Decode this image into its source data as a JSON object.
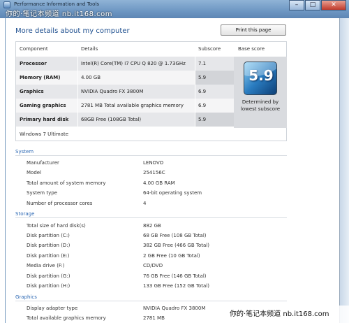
{
  "window": {
    "title": "Performance Information and Tools",
    "watermark_top": "你的·笔记本频道 nb.it168.com",
    "minimize": "–",
    "maximize": "□",
    "close": "✕"
  },
  "page": {
    "title": "More details about my computer",
    "print_label": "Print this page"
  },
  "score_table": {
    "headers": {
      "component": "Component",
      "details": "Details",
      "subscore": "Subscore",
      "base": "Base score"
    },
    "rows": [
      {
        "component": "Processor",
        "details": "Intel(R) Core(TM) i7 CPU Q 820 @ 1.73GHz",
        "subscore": "7.1"
      },
      {
        "component": "Memory (RAM)",
        "details": "4.00 GB",
        "subscore": "5.9"
      },
      {
        "component": "Graphics",
        "details": "NVIDIA Quadro FX 3800M",
        "subscore": "6.9"
      },
      {
        "component": "Gaming graphics",
        "details": "2781 MB Total available graphics memory",
        "subscore": "6.9"
      },
      {
        "component": "Primary hard disk",
        "details": "68GB Free (108GB Total)",
        "subscore": "5.9"
      }
    ],
    "base_score": "5.9",
    "base_caption_1": "Determined by",
    "base_caption_2": "lowest subscore",
    "os": "Windows 7 Ultimate"
  },
  "system": {
    "heading": "System",
    "items": [
      {
        "label": "Manufacturer",
        "value": "LENOVO"
      },
      {
        "label": "Model",
        "value": "254156C"
      },
      {
        "label": "Total amount of system memory",
        "value": "4.00 GB RAM"
      },
      {
        "label": "System type",
        "value": "64-bit operating system"
      },
      {
        "label": "Number of processor cores",
        "value": "4"
      }
    ]
  },
  "storage": {
    "heading": "Storage",
    "items": [
      {
        "label": "Total size of hard disk(s)",
        "value": "882 GB"
      },
      {
        "label": "Disk partition (C:)",
        "value": "68 GB Free (108 GB Total)"
      },
      {
        "label": "Disk partition (D:)",
        "value": "382 GB Free (466 GB Total)"
      },
      {
        "label": "Disk partition (E:)",
        "value": "2 GB Free (10 GB Total)"
      },
      {
        "label": "Media drive (F:)",
        "value": "CD/DVD"
      },
      {
        "label": "Disk partition (G:)",
        "value": "76 GB Free (146 GB Total)"
      },
      {
        "label": "Disk partition (H:)",
        "value": "133 GB Free (152 GB Total)"
      }
    ]
  },
  "graphics": {
    "heading": "Graphics",
    "items": [
      {
        "label": "Display adapter type",
        "value": "NVIDIA Quadro FX 3800M"
      },
      {
        "label": "Total available graphics memory",
        "value": "2781 MB"
      }
    ]
  },
  "watermark_bottom": "你的·笔记本频道 nb.it168.com"
}
